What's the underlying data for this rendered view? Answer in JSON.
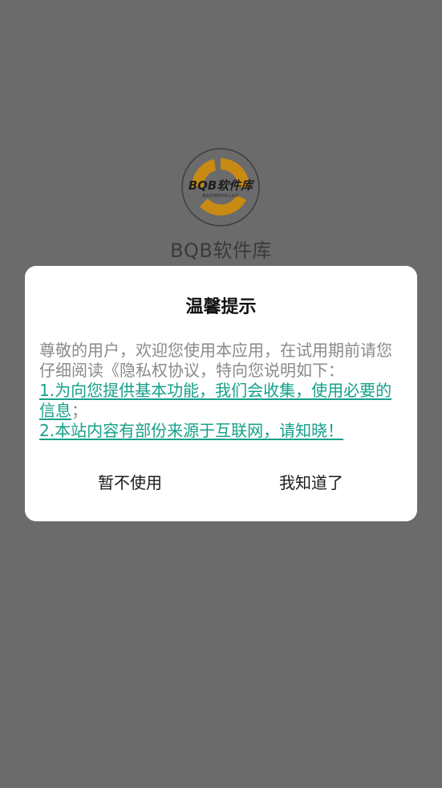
{
  "app": {
    "logo_text": "BQB软件库",
    "logo_subtext": "精品资源软件开心分享",
    "name": "BQB软件库"
  },
  "dialog": {
    "title": "温馨提示",
    "intro": "尊敬的用户，欢迎您使用本应用，在试用期前请您仔细阅读《隐私权协议，特向您说明如下：",
    "points": [
      {
        "link": "1.为向您提供基本功能，我们会收集，使用必要的信息",
        "suffix": "；"
      },
      {
        "link": "2.本站内容有部份来源于互联网，请知晓！",
        "suffix": ""
      }
    ],
    "cancel_label": "暂不使用",
    "ok_label": "我知道了"
  },
  "colors": {
    "backdrop": "#6b6b6b",
    "link": "#15a08a",
    "logo_orange": "#c98a14"
  }
}
